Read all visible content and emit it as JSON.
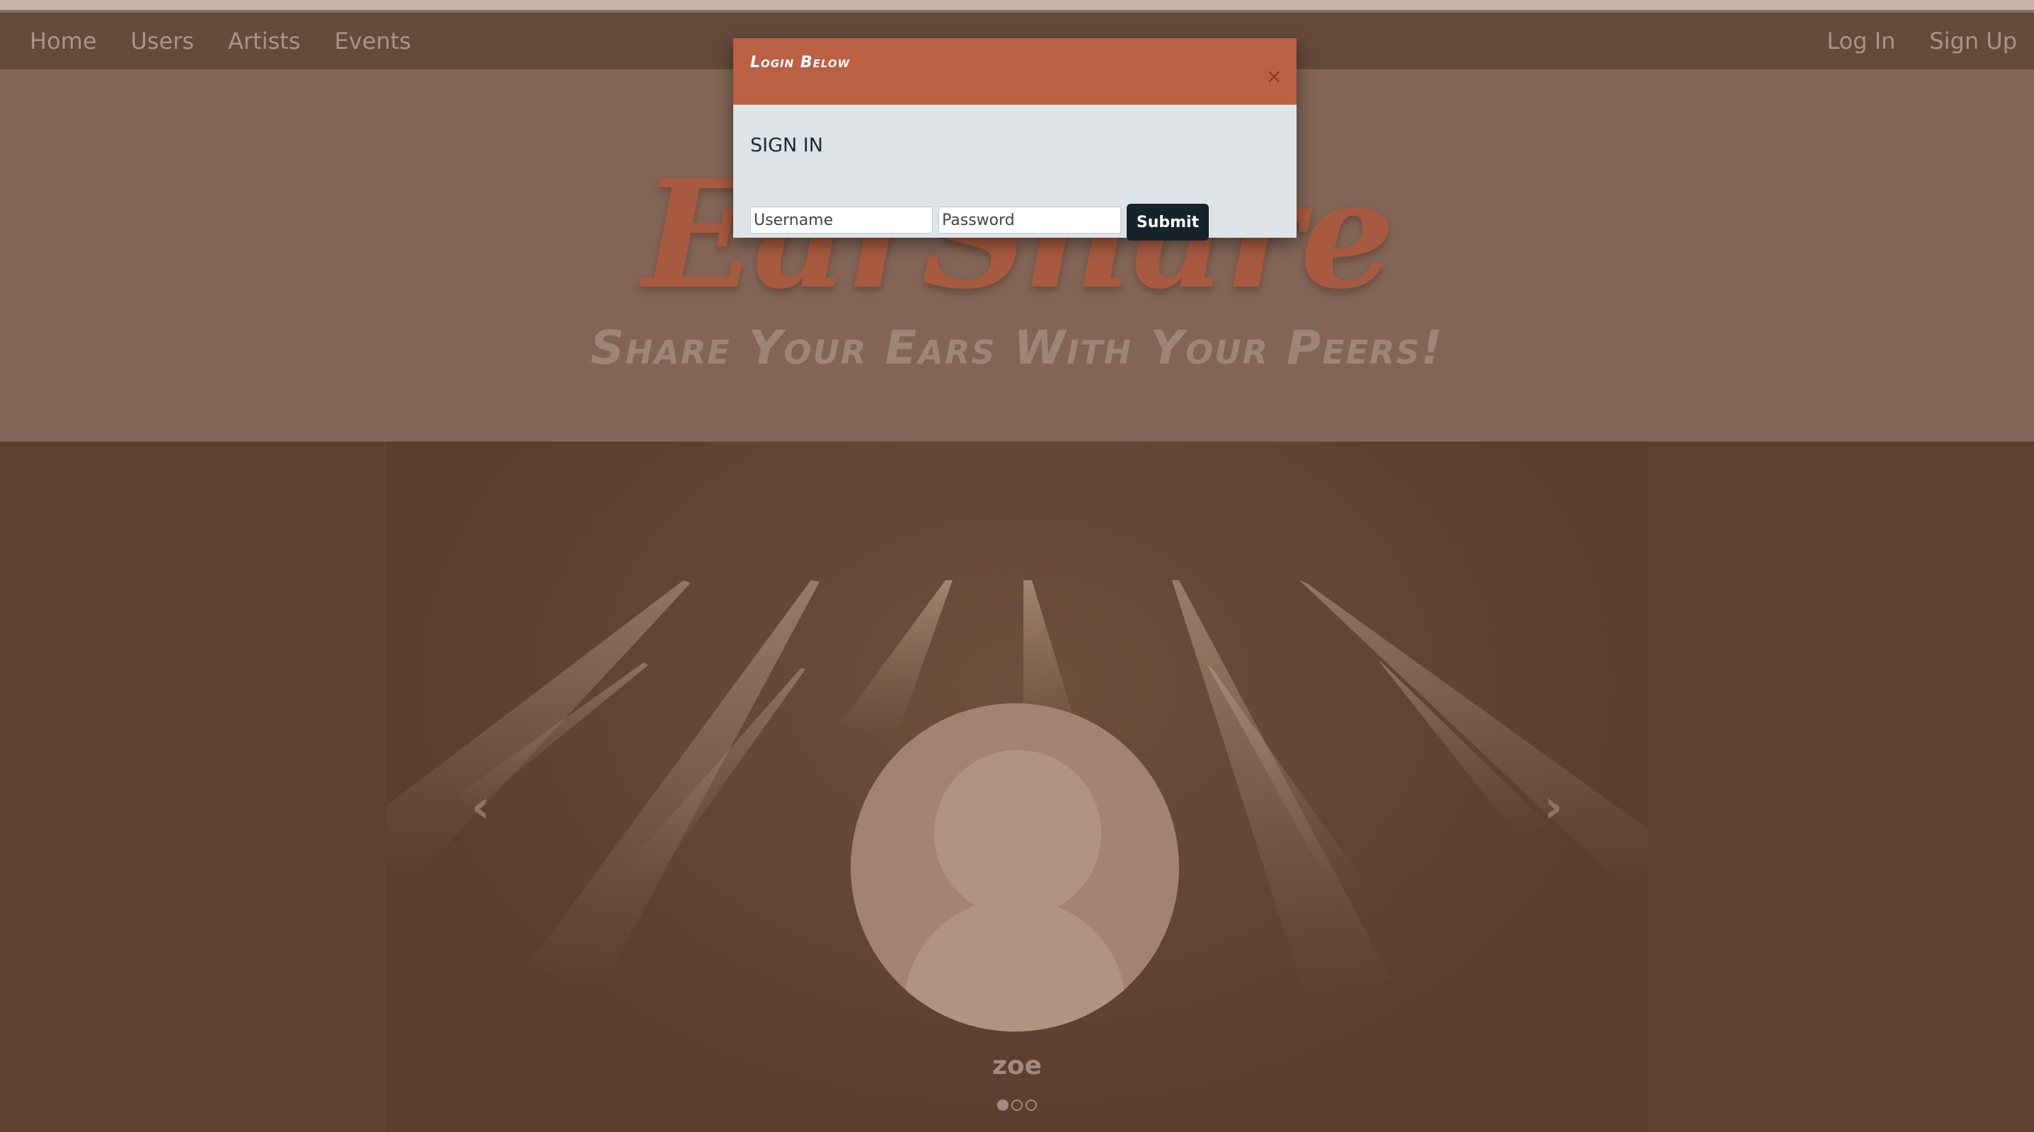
{
  "nav": {
    "left": [
      "Home",
      "Users",
      "Artists",
      "Events"
    ],
    "right": [
      "Log In",
      "Sign Up"
    ]
  },
  "hero": {
    "brand": "EarShare",
    "tagline": "Share Your Ears With Your Peers!"
  },
  "carousel": {
    "name": "zoe",
    "indicators": 3,
    "active_index": 0,
    "prev_icon": "chevron-left-icon",
    "next_icon": "chevron-right-icon"
  },
  "modal": {
    "title": "Login Below",
    "close_label": "×",
    "heading": "SIGN IN",
    "username_placeholder": "Username",
    "password_placeholder": "Password",
    "submit_label": "Submit"
  },
  "colors": {
    "modal_header": "#bb6043",
    "modal_body": "#dde3e7",
    "submit_bg": "#17232b",
    "page_bg": "#5f4332"
  }
}
